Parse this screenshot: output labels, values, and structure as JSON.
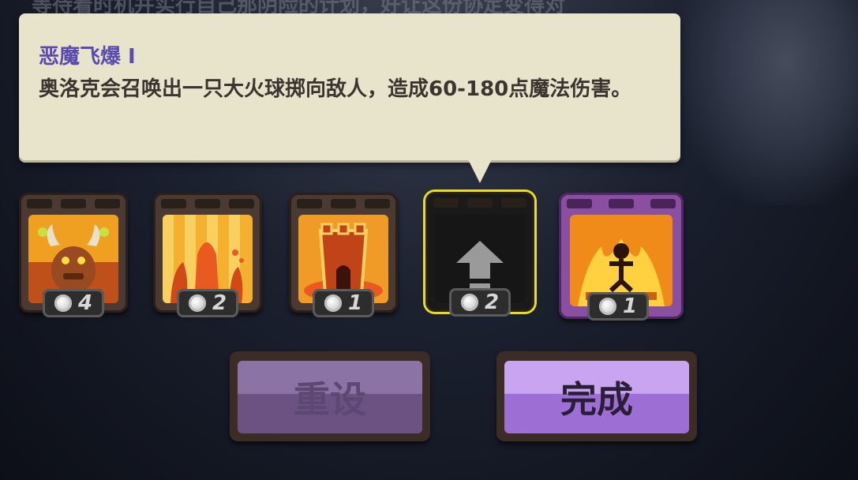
{
  "background": {
    "partial_text": "等待着时机并实行自己那阴险的计划，好让这份协定变得对"
  },
  "tooltip": {
    "title": "恶魔飞爆 I",
    "description": "奥洛克会召唤出一只大火球掷向敌人，造成60-180点魔法伤害。"
  },
  "skills": [
    {
      "icon": "demon-summon-icon",
      "cost": "4"
    },
    {
      "icon": "lava-eruption-icon",
      "cost": "2"
    },
    {
      "icon": "fire-tower-icon",
      "cost": "1"
    },
    {
      "icon": "upgrade-arrow-icon",
      "cost": "2",
      "selected": true
    },
    {
      "icon": "infernal-ritual-icon",
      "cost": "1",
      "style": "purple"
    }
  ],
  "buttons": {
    "reset_label": "重设",
    "done_label": "完成"
  },
  "colors": {
    "tooltip_title": "#5b4bb0",
    "selected_border": "#e6e015",
    "button_purple": "#c9a4f0"
  }
}
